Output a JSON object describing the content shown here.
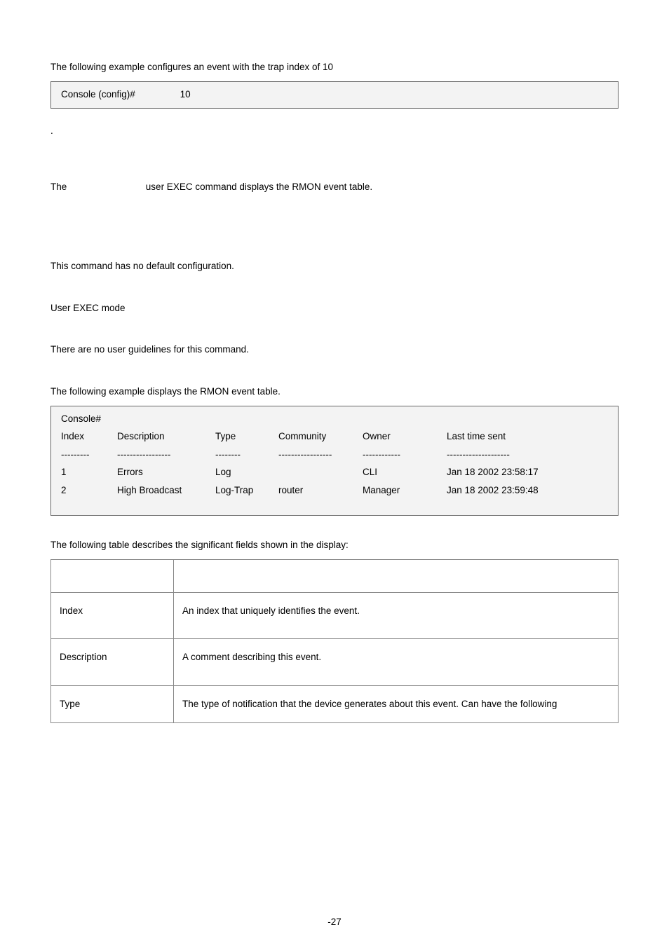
{
  "intro_example_text": "The following example configures an event with the trap index of 10",
  "codebox1": {
    "prompt": "Console (config)#",
    "arg": "10"
  },
  "dot": ".",
  "desc_line_left": "The",
  "desc_line_right": "user EXEC command displays the RMON event table.",
  "default_text": "This command has no default configuration.",
  "mode_text": "User EXEC mode",
  "guidelines_text": "There are no user guidelines for this command.",
  "example2_intro": "The following example displays the RMON event table.",
  "console_prompt": "Console#",
  "headers": {
    "index": "Index",
    "desc": "Description",
    "type": "Type",
    "comm": "Community",
    "owner": "Owner",
    "last": "Last time sent"
  },
  "dashes": {
    "index": "---------",
    "desc": "-----------------",
    "type": "--------",
    "comm": "-----------------",
    "owner": "------------",
    "last": "--------------------"
  },
  "rows": [
    {
      "index": "1",
      "desc": "Errors",
      "type": "Log",
      "comm": "",
      "owner": "CLI",
      "last": "Jan 18 2002 23:58:17"
    },
    {
      "index": "2",
      "desc": "High Broadcast",
      "type": "Log-Trap",
      "comm": "router",
      "owner": "Manager",
      "last": "Jan 18 2002 23:59:48"
    }
  ],
  "table_intro": "The following table describes the significant fields shown in the display:",
  "fields_table": [
    {
      "field": "Index",
      "desc": "An index that uniquely identifies the event."
    },
    {
      "field": "Description",
      "desc": "A comment describing this event."
    },
    {
      "field": "Type",
      "desc": "The type of notification that the device generates about this event. Can have the following"
    }
  ],
  "page_number": "-27"
}
